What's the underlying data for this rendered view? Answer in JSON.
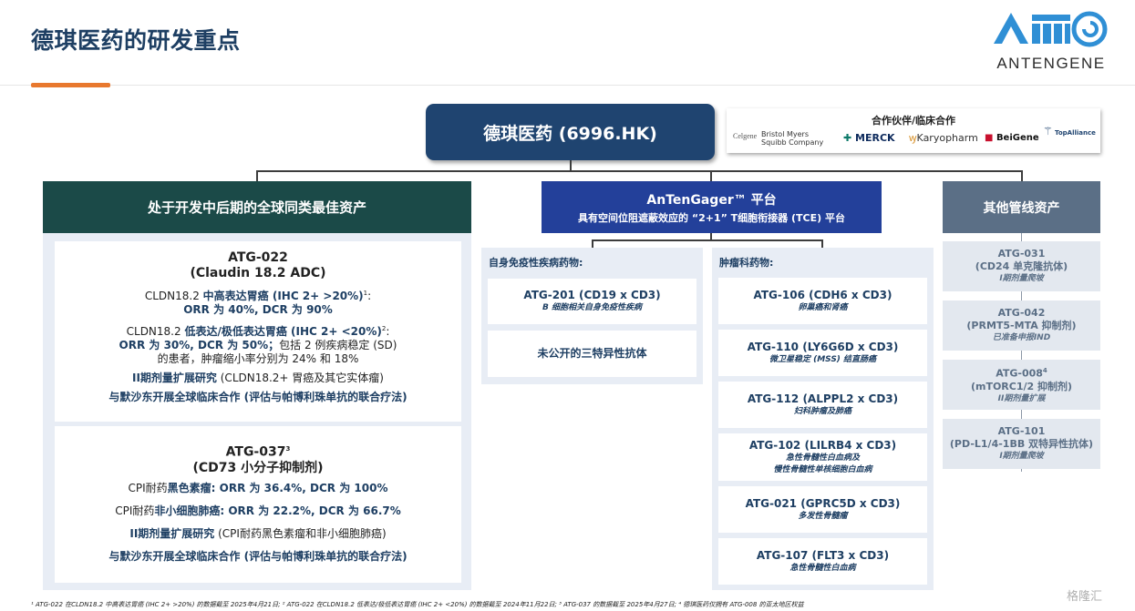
{
  "title": "德琪医药的研发重点",
  "logo": {
    "text": "ANTENGENE",
    "brand_color": "#2f8fd5"
  },
  "company": {
    "name": "德琪医药 (6996.HK)"
  },
  "partners": {
    "title": "合作伙伴/临床合作",
    "logos": [
      "Celgene",
      "Bristol Myers Squibb Company",
      "MERCK",
      "Karyopharm",
      "BeiGene",
      "TopAlliance"
    ]
  },
  "columns": {
    "left": {
      "header": "处于开发中后期的全球同类最佳资产"
    },
    "middle": {
      "header_line1": "AnTenGager™ 平台",
      "header_line2": "具有空间位阻遮蔽效应的 “2+1” T细胞衔接器 (TCE) 平台"
    },
    "right": {
      "header": "其他管线资产"
    }
  },
  "atg022": {
    "name": "ATG-022",
    "subtitle": "(Claudin 18.2 ADC)",
    "high_prefix": "CLDN18.2 ",
    "high_bold": "中高表达胃癌 (IHC 2+ >20%)",
    "high_sup": "1",
    "high_suffix": ":",
    "high_result": "ORR 为 40%, DCR 为 90%",
    "low_prefix": "CLDN18.2 ",
    "low_bold": "低表达/极低表达胃癌 (IHC 2+ <20%)",
    "low_sup": "2",
    "low_suffix": ":",
    "low_result_bold": "ORR 为 30%, DCR 为 50%；",
    "low_result_rest": "包括 2 例疾病稳定 (SD)",
    "low_result_line3": "的患者，肿瘤缩小率分别为 24% 和 18%",
    "phase_bold": "II期剂量扩展研究",
    "phase_rest": " (CLDN18.2+ 胃癌及其它实体瘤)",
    "collab": "与默沙东开展全球临床合作 (评估与帕博利珠单抗的联合疗法)"
  },
  "atg037": {
    "name": "ATG-037",
    "name_sup": "3",
    "subtitle": "(CD73 小分子抑制剂)",
    "melanoma_prefix": "CPI耐药",
    "melanoma_bold": "黑色素瘤: ORR 为 36.4%, DCR 为 100%",
    "nsclc_prefix": "CPI耐药",
    "nsclc_bold": "非小细胞肺癌:  ORR 为 22.2%, DCR 为 66.7%",
    "phase_bold": "II期剂量扩展研究",
    "phase_rest": " (CPI耐药黑色素瘤和非小细胞肺癌)",
    "collab": "与默沙东开展全球临床合作 (评估与帕博利珠单抗的联合疗法)"
  },
  "autoimmune": {
    "title": "自身免疫性疾病药物:",
    "drugs": [
      {
        "name": "ATG-201 (CD19 x CD3)",
        "desc": "B 细胞相关自身免疫性疾病"
      },
      {
        "name": "未公开的三特异性抗体",
        "desc": ""
      }
    ]
  },
  "oncology": {
    "title": "肿瘤科药物:",
    "drugs": [
      {
        "name": "ATG-106 (CDH6 x CD3)",
        "desc": "卵巢癌和肾癌",
        "desc2": ""
      },
      {
        "name": "ATG-110 (LY6G6D x CD3)",
        "desc": "微卫星稳定 (MSS) 结直肠癌",
        "desc2": ""
      },
      {
        "name": "ATG-112 (ALPPL2 x CD3)",
        "desc": "妇科肿瘤及肺癌",
        "desc2": ""
      },
      {
        "name": "ATG-102 (LILRB4 x CD3)",
        "desc": "急性骨髓性白血病及",
        "desc2": "慢性骨髓性单核细胞白血病"
      },
      {
        "name": "ATG-021 (GPRC5D x CD3)",
        "desc": "多发性骨髓瘤",
        "desc2": ""
      },
      {
        "name": "ATG-107 (FLT3 x CD3)",
        "desc": "急性骨髓性白血病",
        "desc2": ""
      }
    ]
  },
  "other_assets": [
    {
      "name": "ATG-031",
      "sup": "",
      "target": "(CD24 单克隆抗体)",
      "phase": "I期剂量爬坡"
    },
    {
      "name": "ATG-042",
      "sup": "",
      "target": "(PRMT5-MTA 抑制剂)",
      "phase": "已准备申报IND"
    },
    {
      "name": "ATG-008",
      "sup": "4",
      "target": "(mTORC1/2 抑制剂)",
      "phase": "II期剂量扩展"
    },
    {
      "name": "ATG-101",
      "sup": "",
      "target": "(PD-L1/4-1BB 双特异性抗体)",
      "phase": "I期剂量爬坡"
    }
  ],
  "footnote": "¹ ATG-022 在CLDN18.2 中高表达胃癌 (IHC 2+ >20%) 的数据截至 2025年4月21日;  ² ATG-022 在CLDN18.2 低表达/极低表达胃癌 (IHC 2+ <20%) 的数据截至 2024年11月22日;  ³ ATG-037 的数据截至 2025年4月27日;  ⁴ 德琪医药仅拥有 ATG-008 的亚太地区权益",
  "watermark": "格隆汇"
}
